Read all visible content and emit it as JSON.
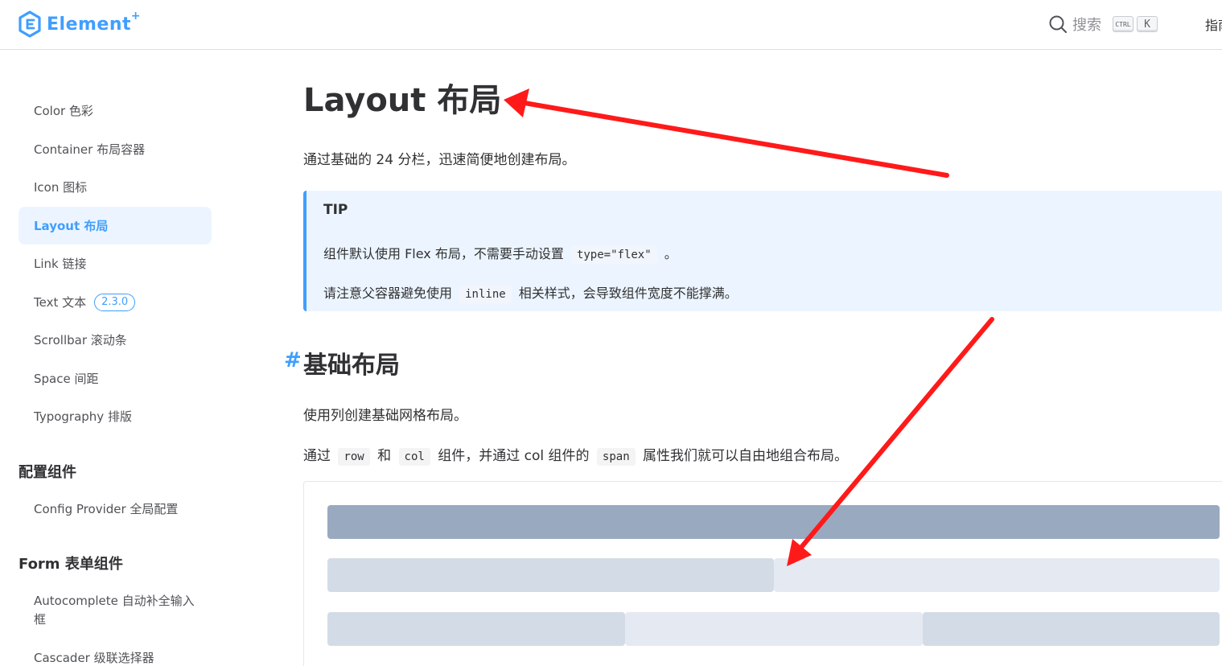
{
  "header": {
    "brand": "Element",
    "brand_sup": "+",
    "search_label": "搜索",
    "kbd_ctrl": "CTRL",
    "kbd_k": "K",
    "nav_guide": "指南"
  },
  "sidebar": {
    "items": [
      {
        "label": "Color 色彩"
      },
      {
        "label": "Container 布局容器"
      },
      {
        "label": "Icon 图标"
      },
      {
        "label": "Layout 布局",
        "active": true
      },
      {
        "label": "Link 链接"
      },
      {
        "label": "Text 文本",
        "badge": "2.3.0"
      },
      {
        "label": "Scrollbar 滚动条"
      },
      {
        "label": "Space 间距"
      },
      {
        "label": "Typography 排版"
      }
    ],
    "group_config": "配置组件",
    "config_items": [
      {
        "label": "Config Provider 全局配置"
      }
    ],
    "group_form": "Form 表单组件",
    "form_items": [
      {
        "label": "Autocomplete 自动补全输入框"
      },
      {
        "label": "Cascader 级联选择器"
      }
    ]
  },
  "main": {
    "title": "Layout 布局",
    "intro": "通过基础的 24 分栏，迅速简便地创建布局。",
    "tip": {
      "title": "TIP",
      "line1_pre": "组件默认使用 Flex 布局，不需要手动设置",
      "line1_code": "type=\"flex\"",
      "line1_post": "。",
      "line2_pre": "请注意父容器避免使用",
      "line2_code": "inline",
      "line2_post": "相关样式，会导致组件宽度不能撑满。"
    },
    "section_hash": "#",
    "section_title": "基础布局",
    "para1": "使用列创建基础网格布局。",
    "para2": {
      "pre": "通过",
      "code1": "row",
      "mid1": "和",
      "code2": "col",
      "mid2": "组件，并通过 col 组件的",
      "code3": "span",
      "post": "属性我们就可以自由地组合布局。"
    }
  },
  "colors": {
    "accent": "#409eff",
    "tip_bg": "#ecf5ff",
    "col_dark": "#99a9bf",
    "col_mid": "#d3dce6",
    "col_light": "#e5e9f2",
    "annotation_arrow": "#ff0000"
  }
}
